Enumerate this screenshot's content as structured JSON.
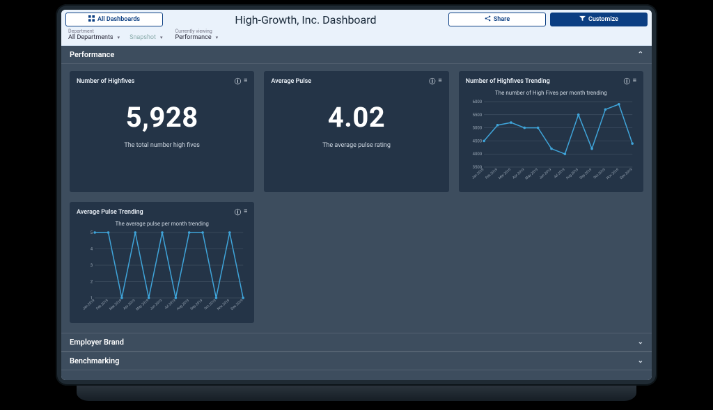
{
  "header": {
    "all_dashboards_label": "All Dashboards",
    "title": "High-Growth, Inc. Dashboard",
    "share_label": "Share",
    "customize_label": "Customize"
  },
  "filters": {
    "department_label": "Department",
    "department_value": "All Departments",
    "snapshot_label": "Snapshot",
    "viewing_label": "Currently viewing",
    "viewing_value": "Performance"
  },
  "sections": {
    "performance": {
      "title": "Performance",
      "expanded": true
    },
    "employer_brand": {
      "title": "Employer Brand",
      "expanded": false
    },
    "benchmarking": {
      "title": "Benchmarking",
      "expanded": false
    }
  },
  "cards": {
    "highfives": {
      "title": "Number of Highfives",
      "value": "5,928",
      "subtitle": "The total number high fives"
    },
    "avg_pulse": {
      "title": "Average Pulse",
      "value": "4.02",
      "subtitle": "The average pulse rating"
    },
    "highfives_trend": {
      "title": "Number of Highfives Trending",
      "chart_title": "The number of High Fives per month trending"
    },
    "avg_pulse_trend": {
      "title": "Average Pulse Trending",
      "chart_title": "The average pulse per month trending"
    }
  },
  "chart_data": [
    {
      "id": "highfives_trend",
      "type": "line",
      "title": "The number of High Fives per month trending",
      "categories": [
        "Jan 2019",
        "Feb 2019",
        "Mar 2019",
        "Apr 2019",
        "May 2019",
        "Jun 2019",
        "Jul 2019",
        "Aug 2019",
        "Sep 2019",
        "Oct 2019",
        "Nov 2019",
        "Dec 2019"
      ],
      "values": [
        4500,
        5100,
        5200,
        5000,
        5000,
        4200,
        4000,
        5500,
        4200,
        5700,
        5900,
        4400
      ],
      "ylim": [
        3500,
        6000
      ],
      "yticks": [
        3500,
        4000,
        4500,
        5000,
        5500,
        6000
      ],
      "xlabel": "",
      "ylabel": ""
    },
    {
      "id": "avg_pulse_trend",
      "type": "line",
      "title": "The average pulse per month trending",
      "categories": [
        "Jan 2019",
        "Feb 2019",
        "Mar 2019",
        "Apr 2019",
        "May 2019",
        "Jun 2019",
        "Jul 2019",
        "Aug 2019",
        "Sep 2019",
        "Oct 2019",
        "Nov 2019",
        "Dec 2019"
      ],
      "values": [
        5,
        5,
        1,
        5,
        1,
        5,
        1,
        5,
        5,
        1,
        5,
        1
      ],
      "ylim": [
        1,
        5
      ],
      "yticks": [
        1,
        2,
        3,
        4,
        5
      ],
      "xlabel": "",
      "ylabel": ""
    }
  ],
  "colors": {
    "line": "#3fa4d9",
    "grid": "#4a5a6d",
    "axis_text": "#9aa7b5"
  }
}
